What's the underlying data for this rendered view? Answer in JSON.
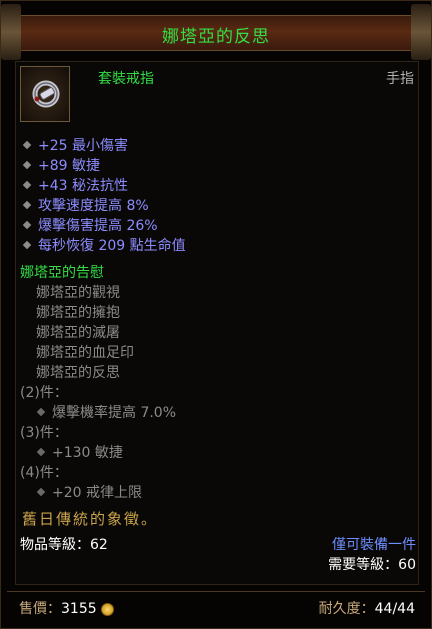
{
  "title": "娜塔亞的反思",
  "item": {
    "type": "套裝戒指",
    "slot": "手指",
    "icon": "ring-icon"
  },
  "affixes": [
    "+25 最小傷害",
    "+89 敏捷",
    "+43 秘法抗性",
    "攻擊速度提高 8%",
    "爆擊傷害提高 26%",
    "每秒恢復 209 點生命值"
  ],
  "set": {
    "name": "娜塔亞的告慰",
    "pieces": [
      "娜塔亞的觀視",
      "娜塔亞的擁抱",
      "娜塔亞的滅屠",
      "娜塔亞的血足印",
      "娜塔亞的反思"
    ],
    "bonuses": [
      {
        "count": "(2)件：",
        "effect": "爆擊機率提高 7.0%"
      },
      {
        "count": "(3)件：",
        "effect": "+130 敏捷"
      },
      {
        "count": "(4)件：",
        "effect": "+20 戒律上限"
      }
    ]
  },
  "flavor": "舊日傳統的象徵。",
  "item_level": "物品等級：62",
  "equip_restriction": "僅可裝備一件",
  "required_level": "需要等級：60",
  "footer": {
    "price_label": "售價：",
    "price_value": "3155",
    "durability_label": "耐久度：",
    "durability_value": "44/44"
  },
  "colors": {
    "set_green": "#33dd44",
    "magic_blue": "#8c8cff",
    "gray": "#8a8a8a",
    "gold": "#c9a34b"
  }
}
